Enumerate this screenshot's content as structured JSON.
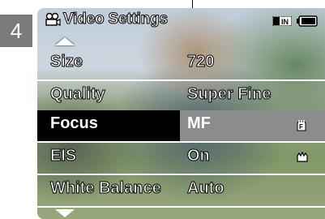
{
  "step": "4",
  "title": "Video Settings",
  "icons": {
    "camera": "video-camera-icon",
    "in_indicator": "IN",
    "battery": "battery-icon",
    "focus_mf": "manual-focus-icon",
    "eis": "anti-shake-hand-icon"
  },
  "rows": [
    {
      "label": "Size",
      "value": "720"
    },
    {
      "label": "Quality",
      "value": "Super Fine"
    },
    {
      "label": "Focus",
      "value": "MF"
    },
    {
      "label": "EIS",
      "value": "On"
    },
    {
      "label": "White Balance",
      "value": "Auto"
    }
  ],
  "selected_row": "Focus"
}
